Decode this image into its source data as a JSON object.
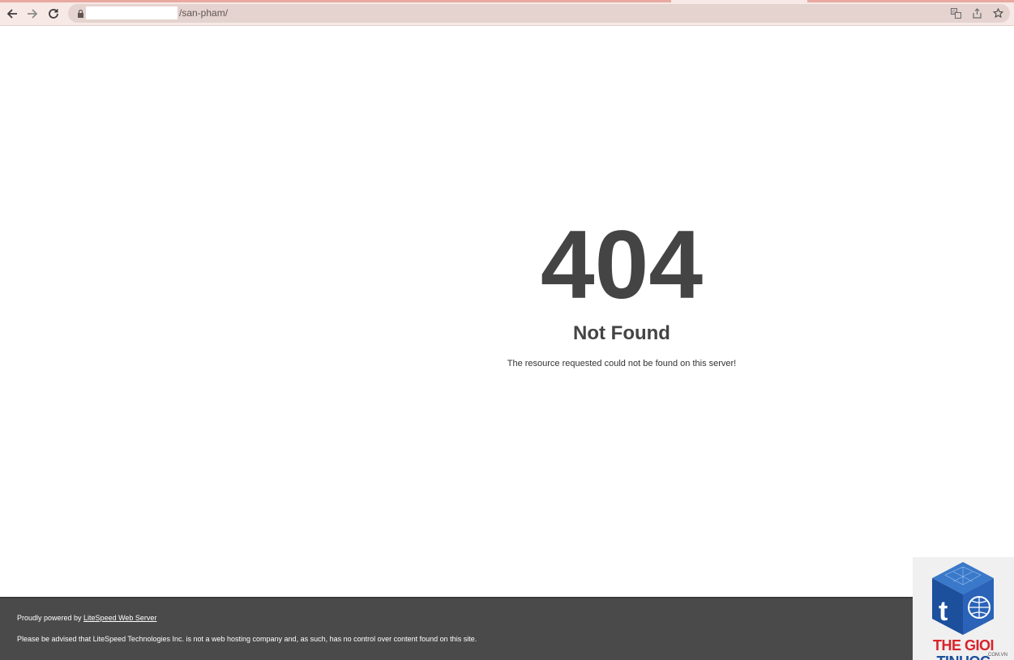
{
  "browser": {
    "url_path": "/san-pham/",
    "icons": [
      "back-icon",
      "forward-icon",
      "reload-icon",
      "lock-icon",
      "translate-icon",
      "share-icon",
      "star-icon"
    ]
  },
  "error": {
    "code": "404",
    "title": "Not Found",
    "message": "The resource requested could not be found on this server!"
  },
  "footer": {
    "powered_prefix": "Proudly powered by ",
    "powered_link": "LiteSpeed Web Server",
    "disclaimer": "Please be advised that LiteSpeed Technologies Inc. is not a web hosting company and, as such, has no control over content found on this site."
  },
  "watermark": {
    "brand_part1": "THE GIOI ",
    "brand_part2": "TINHOC",
    "brand_sub": ".COM.VN",
    "colors": {
      "red": "#d9232a",
      "blue": "#1c4f9c"
    }
  },
  "colors": {
    "heading": "#444444",
    "footer_bg": "#4a4a4a",
    "chrome_bg": "#f7e9e6"
  }
}
